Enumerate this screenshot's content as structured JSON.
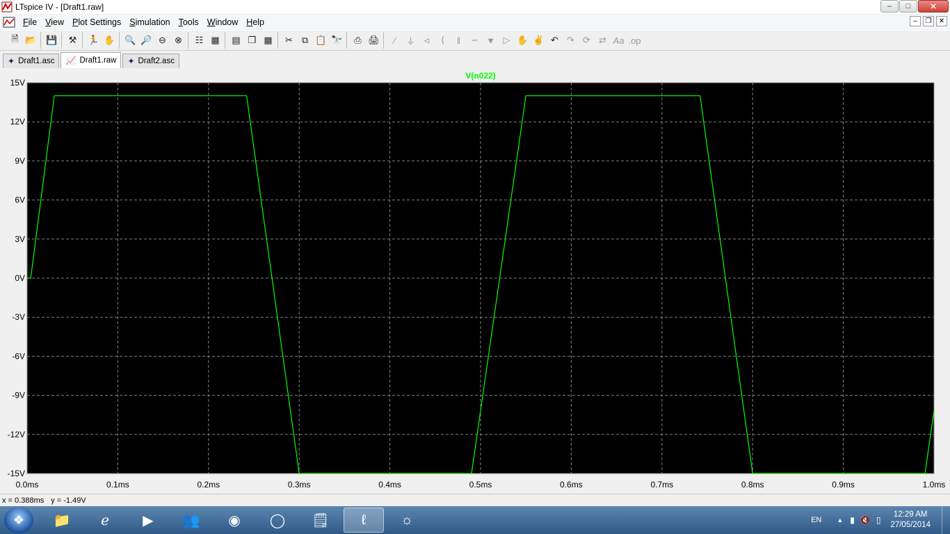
{
  "window": {
    "title": "LTspice IV - [Draft1.raw]",
    "app_icon": "ltspice-icon",
    "buttons": [
      "minimize",
      "maximize",
      "close"
    ]
  },
  "menu": {
    "items": [
      {
        "label": "File",
        "key": "F"
      },
      {
        "label": "View",
        "key": "V"
      },
      {
        "label": "Plot Settings",
        "key": "P"
      },
      {
        "label": "Simulation",
        "key": "S"
      },
      {
        "label": "Tools",
        "key": "T"
      },
      {
        "label": "Window",
        "key": "W"
      },
      {
        "label": "Help",
        "key": "H"
      }
    ]
  },
  "toolbar": {
    "icons": [
      "new-schematic-icon",
      "open-icon",
      "save-icon",
      "hammer-icon",
      "run-icon",
      "pan-hand-icon",
      "zoom-in-icon",
      "zoom-area-icon",
      "zoom-out-icon",
      "zoom-fit-icon",
      "autorange-icon",
      "grid-icon",
      "tile-horizontal-icon",
      "cascade-icon",
      "tile-icon",
      "cut-icon",
      "copy-icon",
      "paste-icon",
      "find-icon",
      "print-setup-icon",
      "print-icon",
      "wire-icon",
      "ground-icon",
      "label-icon",
      "resistor-icon",
      "capacitor-icon",
      "inductor-icon",
      "diode-icon",
      "component-icon",
      "move-icon",
      "drag-icon",
      "undo-icon",
      "redo-icon",
      "rotate-icon",
      "mirror-icon",
      "text-icon",
      "spice-directive-icon"
    ]
  },
  "tabs": [
    {
      "label": "Draft1.asc",
      "icon": "schematic-icon",
      "active": false
    },
    {
      "label": "Draft1.raw",
      "icon": "waveform-icon",
      "active": true
    },
    {
      "label": "Draft2.asc",
      "icon": "schematic-icon",
      "active": false
    }
  ],
  "colors": {
    "plot_background": "#000000",
    "trace": "#00ff00",
    "grid": "#808080",
    "axis_text": "#000000"
  },
  "chart_data": {
    "type": "line",
    "title": "",
    "xlabel": "",
    "ylabel": "",
    "xlim": [
      0.0,
      1.0
    ],
    "ylim": [
      -15,
      15
    ],
    "x_ticks": [
      "0.0ms",
      "0.1ms",
      "0.2ms",
      "0.3ms",
      "0.4ms",
      "0.5ms",
      "0.6ms",
      "0.7ms",
      "0.8ms",
      "0.9ms",
      "1.0ms"
    ],
    "y_ticks": [
      "15V",
      "12V",
      "9V",
      "6V",
      "3V",
      "0V",
      "-3V",
      "-6V",
      "-9V",
      "-12V",
      "-15V"
    ],
    "grid": true,
    "series": [
      {
        "name": "V(n022)",
        "x": [
          0.0,
          0.004,
          0.03,
          0.242,
          0.3,
          0.49,
          0.55,
          0.742,
          0.8,
          0.99,
          1.0
        ],
        "y": [
          0.0,
          0.0,
          14.0,
          14.0,
          -15.0,
          -15.0,
          14.0,
          14.0,
          -15.0,
          -15.0,
          -10.2
        ]
      }
    ]
  },
  "status": {
    "x": "x = 0.388ms",
    "y": "y = -1.49V"
  },
  "taskbar": {
    "apps": [
      "start-orb-icon",
      "explorer-icon",
      "internet-explorer-icon",
      "media-player-icon",
      "network-people-icon",
      "picasa-icon",
      "chrome-icon",
      "sticky-notes-icon",
      "ltspice-icon",
      "firefox-icon"
    ],
    "active_app": "ltspice-icon",
    "lang": "EN",
    "time": "12:29 AM",
    "date": "27/05/2014"
  }
}
